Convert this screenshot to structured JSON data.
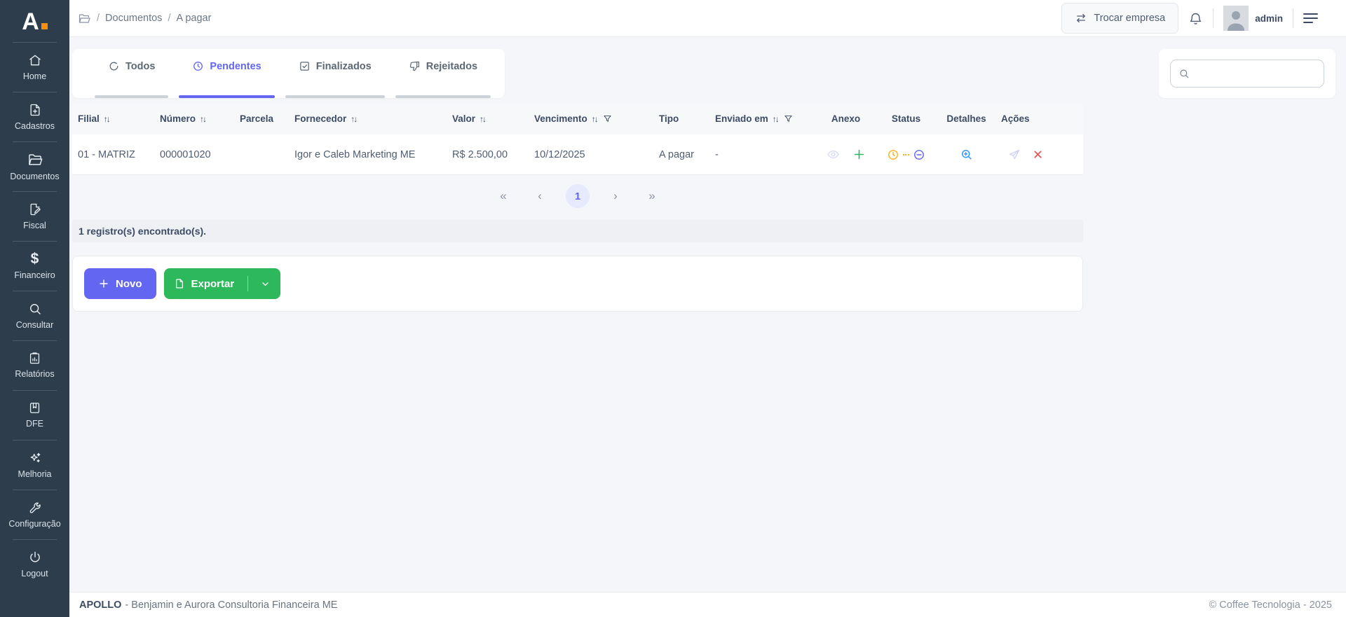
{
  "app": {
    "logo_letter": "A",
    "footer_brand": "APOLLO",
    "footer_company": "- Benjamin e Aurora Consultoria Financeira ME",
    "footer_copyright": "© Coffee Tecnologia - 2025"
  },
  "colors": {
    "accent": "#6366f1",
    "success": "#2eb85c",
    "danger": "#e55353",
    "warning": "#f9b115",
    "info": "#3399ff",
    "sidebar_bg": "#2e3d4b",
    "logo_dot": "#f98e08"
  },
  "sidebar": {
    "items": [
      {
        "label": "Home",
        "icon": "home-icon"
      },
      {
        "label": "Cadastros",
        "icon": "file-plus-icon"
      },
      {
        "label": "Documentos",
        "icon": "folder-open-icon"
      },
      {
        "label": "Fiscal",
        "icon": "file-edit-icon"
      },
      {
        "label": "Financeiro",
        "icon": "dollar-icon"
      },
      {
        "label": "Consultar",
        "icon": "search-icon"
      },
      {
        "label": "Relatórios",
        "icon": "clipboard-chart-icon"
      },
      {
        "label": "DFE",
        "icon": "book-icon"
      },
      {
        "label": "Melhoria",
        "icon": "sparkles-icon"
      },
      {
        "label": "Configuração",
        "icon": "wrench-icon"
      },
      {
        "label": "Logout",
        "icon": "power-icon"
      }
    ]
  },
  "icons": {
    "dollar_glyph": "$"
  },
  "header": {
    "breadcrumb": {
      "separator": "/",
      "items": [
        "Documentos",
        "A pagar"
      ]
    },
    "switch_company_label": "Trocar empresa",
    "username": "admin"
  },
  "tabs": [
    {
      "label": "Todos",
      "icon": "circle-icon",
      "active": false
    },
    {
      "label": "Pendentes",
      "icon": "clock-icon",
      "active": true
    },
    {
      "label": "Finalizados",
      "icon": "check-square-icon",
      "active": false
    },
    {
      "label": "Rejeitados",
      "icon": "thumbs-down-icon",
      "active": false
    }
  ],
  "search": {
    "value": "",
    "placeholder": ""
  },
  "table": {
    "sort_glyph": "↑↓",
    "columns": [
      {
        "label": "Filial",
        "sortable": true,
        "filterable": false
      },
      {
        "label": "Número",
        "sortable": true,
        "filterable": false
      },
      {
        "label": "Parcela",
        "sortable": false,
        "filterable": false
      },
      {
        "label": "Fornecedor",
        "sortable": true,
        "filterable": false
      },
      {
        "label": "Valor",
        "sortable": true,
        "filterable": false
      },
      {
        "label": "Vencimento",
        "sortable": true,
        "filterable": true
      },
      {
        "label": "Tipo",
        "sortable": false,
        "filterable": false
      },
      {
        "label": "Enviado em",
        "sortable": true,
        "filterable": true
      },
      {
        "label": "Anexo",
        "sortable": false,
        "filterable": false
      },
      {
        "label": "Status",
        "sortable": false,
        "filterable": false
      },
      {
        "label": "Detalhes",
        "sortable": false,
        "filterable": false
      },
      {
        "label": "Ações",
        "sortable": false,
        "filterable": false
      }
    ],
    "rows": [
      {
        "filial": "01 - MATRIZ",
        "numero": "000001020",
        "parcela": "",
        "fornecedor": "Igor e Caleb Marketing ME",
        "valor": "R$ 2.500,00",
        "vencimento": "10/12/2025",
        "tipo": "A pagar",
        "enviado_em": "-"
      }
    ]
  },
  "pagination": {
    "first_label": "«",
    "prev_label": "‹",
    "page": "1",
    "next_label": "›",
    "last_label": "»"
  },
  "records_summary": "1 registro(s) encontrado(s).",
  "actions": {
    "new_label": "Novo",
    "export_label": "Exportar"
  }
}
